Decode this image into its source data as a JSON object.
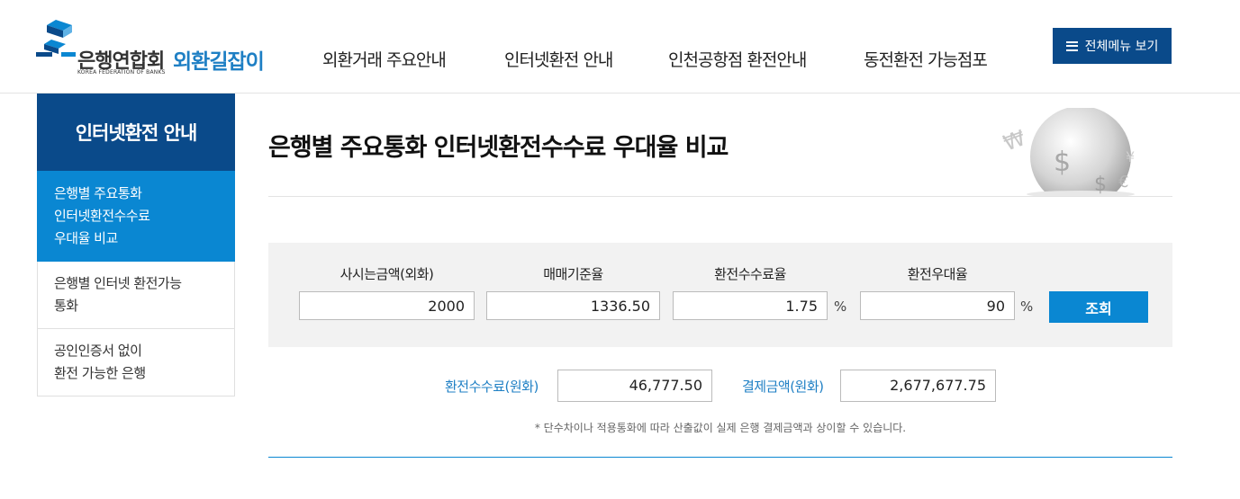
{
  "header": {
    "logo_main": "은행연합회",
    "logo_en": "KOREA FEDERATION OF BANKS",
    "logo_sub": "외환길잡이",
    "nav": [
      "외환거래 주요안내",
      "인터넷환전 안내",
      "인천공항점 환전안내",
      "동전환전 가능점포"
    ],
    "menu_button": "전체메뉴 보기"
  },
  "sidebar": {
    "title": "인터넷환전 안내",
    "items": [
      {
        "label_lines": [
          "은행별 주요통화",
          "인터넷환전수수료",
          "우대율 비교"
        ],
        "active": true
      },
      {
        "label_lines": [
          "은행별 인터넷 환전가능",
          "통화"
        ],
        "active": false
      },
      {
        "label_lines": [
          "공인인증서 없이",
          "환전 가능한 은행"
        ],
        "active": false
      }
    ]
  },
  "main": {
    "title": "은행별 주요통화 인터넷환전수수료 우대율 비교",
    "calc": {
      "labels": {
        "amount": "사시는금액(외화)",
        "rate": "매매기준율",
        "fee_rate": "환전수수료율",
        "discount": "환전우대율"
      },
      "values": {
        "amount": "2000",
        "rate": "1336.50",
        "fee_rate": "1.75",
        "discount": "90"
      },
      "percent_unit": "%",
      "query_button": "조회"
    },
    "result": {
      "fee_label": "환전수수료(원화)",
      "fee_value": "46,777.50",
      "total_label": "결제금액(원화)",
      "total_value": "2,677,677.75"
    },
    "note": "* 단수차이나 적용통화에 따라 산출값이 실제 은행 결제금액과 상이할 수 있습니다."
  },
  "colors": {
    "navy": "#0a4a8a",
    "blue": "#0a87d2",
    "link_blue": "#1e7fc4"
  }
}
